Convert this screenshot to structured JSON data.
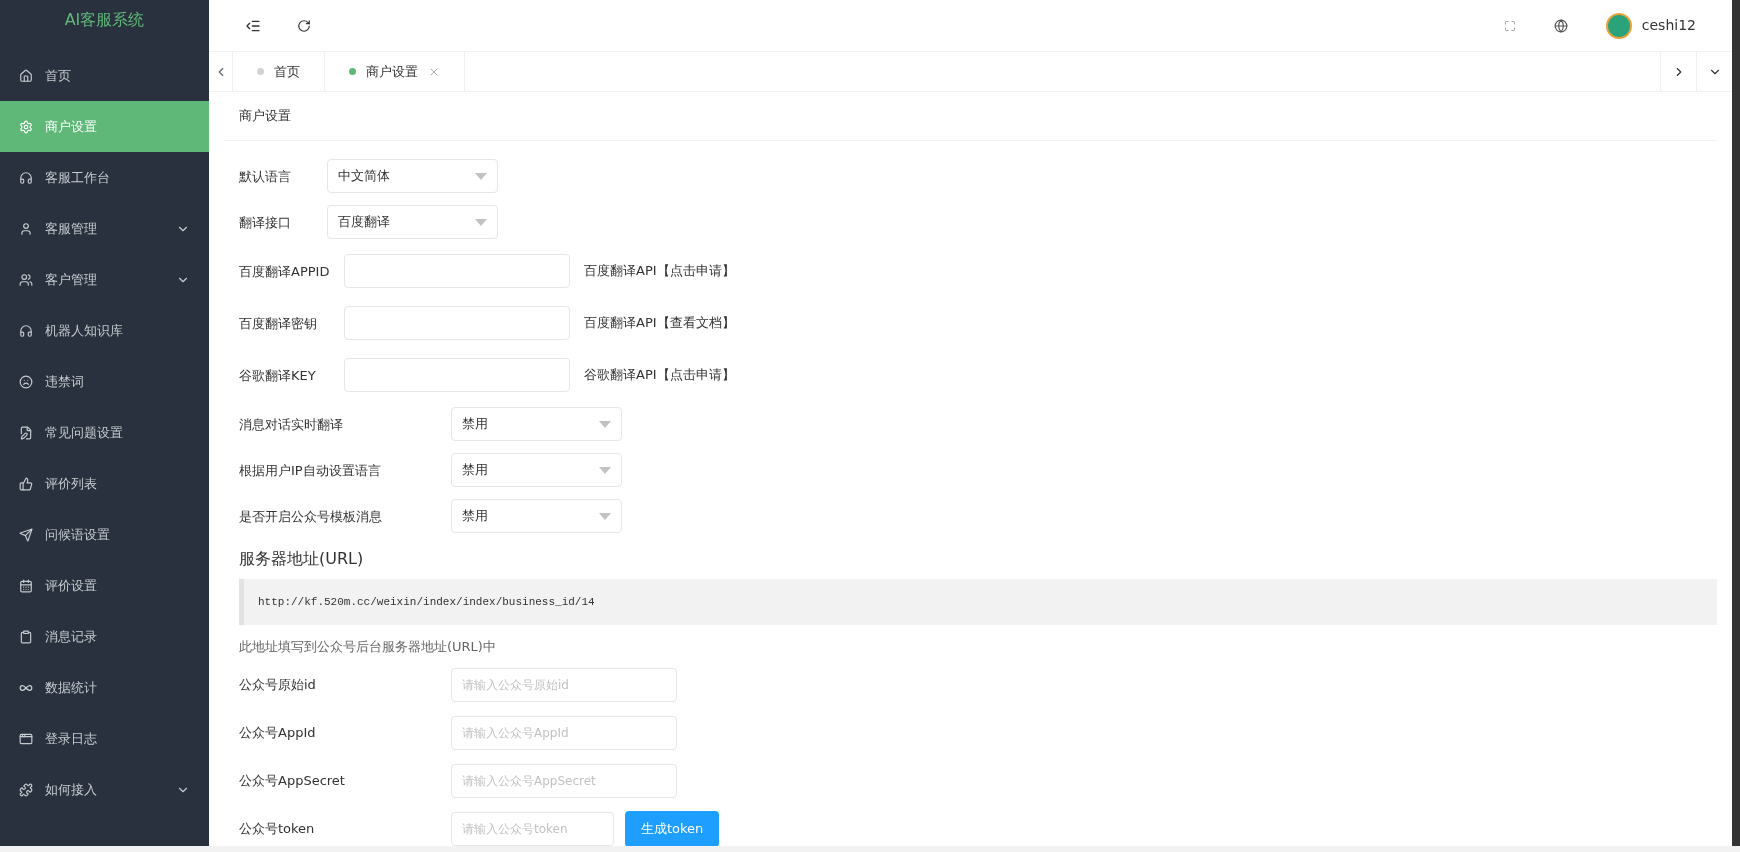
{
  "sidebar": {
    "title": "AI客服系统",
    "items": [
      {
        "label": "首页",
        "selected": false,
        "expandable": false
      },
      {
        "label": "商户设置",
        "selected": true,
        "expandable": false
      },
      {
        "label": "客服工作台",
        "selected": false,
        "expandable": false
      },
      {
        "label": "客服管理",
        "selected": false,
        "expandable": true
      },
      {
        "label": "客户管理",
        "selected": false,
        "expandable": true
      },
      {
        "label": "机器人知识库",
        "selected": false,
        "expandable": false
      },
      {
        "label": "违禁词",
        "selected": false,
        "expandable": false
      },
      {
        "label": "常见问题设置",
        "selected": false,
        "expandable": false
      },
      {
        "label": "评价列表",
        "selected": false,
        "expandable": false
      },
      {
        "label": "问候语设置",
        "selected": false,
        "expandable": false
      },
      {
        "label": "评价设置",
        "selected": false,
        "expandable": false
      },
      {
        "label": "消息记录",
        "selected": false,
        "expandable": false
      },
      {
        "label": "数据统计",
        "selected": false,
        "expandable": false
      },
      {
        "label": "登录日志",
        "selected": false,
        "expandable": false
      },
      {
        "label": "如何接入",
        "selected": false,
        "expandable": true
      }
    ]
  },
  "header": {
    "user": "ceshi12"
  },
  "tabs": [
    {
      "label": "首页",
      "selected": false,
      "closable": false
    },
    {
      "label": "商户设置",
      "selected": true,
      "closable": true
    }
  ],
  "panel": {
    "title": "商户设置",
    "settings": [
      {
        "kind": "select",
        "label": "默认语言",
        "value": "中文简体"
      },
      {
        "kind": "select",
        "label": "翻译接口",
        "value": "百度翻译"
      },
      {
        "kind": "input",
        "label": "百度翻译APPID",
        "link": "百度翻译API【点击申请】"
      },
      {
        "kind": "input",
        "label": "百度翻译密钥",
        "link": "百度翻译API【查看文档】"
      },
      {
        "kind": "input",
        "label": "谷歌翻译KEY",
        "link": "谷歌翻译API【点击申请】"
      },
      {
        "kind": "wide-select",
        "label": "消息对话实时翻译",
        "value": "禁用"
      },
      {
        "kind": "wide-select",
        "label": "根据用户IP自动设置语言",
        "value": "禁用"
      },
      {
        "kind": "wide-select",
        "label": "是否开启公众号模板消息",
        "value": "禁用"
      }
    ],
    "url_heading": "服务器地址(URL)",
    "url": "http://kf.520m.cc/weixin/index/index/business_id/14",
    "url_note": "此地址填写到公众号后台服务器地址(URL)中",
    "wechat_fields": [
      {
        "label": "公众号原始id",
        "placeholder": "请输入公众号原始id"
      },
      {
        "label": "公众号AppId",
        "placeholder": "请输入公众号AppId"
      },
      {
        "label": "公众号AppSecret",
        "placeholder": "请输入公众号AppSecret"
      },
      {
        "label": "公众号token",
        "placeholder": "请输入公众号token",
        "button": "生成token"
      }
    ]
  }
}
